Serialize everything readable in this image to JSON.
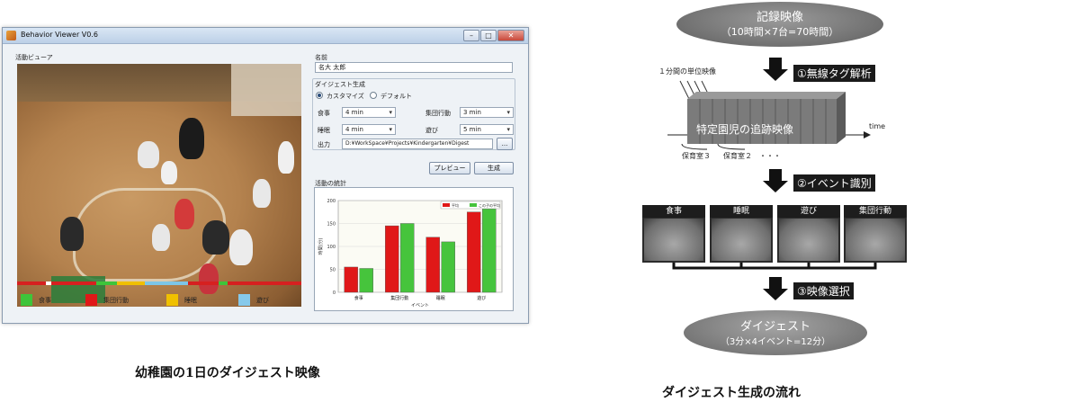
{
  "window": {
    "title": "Behavior Viewer V0.6",
    "controls": {
      "minimize": "–",
      "maximize": "□",
      "close": "✕"
    }
  },
  "viewer": {
    "label": "活動ビューア"
  },
  "timeline": {
    "segments": [
      {
        "color": "#d62020",
        "fraction": 0.1
      },
      {
        "color": "#ffffff",
        "fraction": 0.02
      },
      {
        "color": "#d62020",
        "fraction": 0.16
      },
      {
        "color": "#3ec43a",
        "fraction": 0.07
      },
      {
        "color": "#f0c000",
        "fraction": 0.1
      },
      {
        "color": "#7cc6e8",
        "fraction": 0.15
      },
      {
        "color": "#d62020",
        "fraction": 0.11
      },
      {
        "color": "#3ec43a",
        "fraction": 0.03
      },
      {
        "color": "#d62020",
        "fraction": 0.26
      }
    ]
  },
  "legend": [
    {
      "label": "食事",
      "color": "#3ec43a"
    },
    {
      "label": "集団行動",
      "color": "#e01818"
    },
    {
      "label": "睡眠",
      "color": "#f0c000"
    },
    {
      "label": "遊び",
      "color": "#86c9ea"
    }
  ],
  "form": {
    "name_label": "名前",
    "name_value": "名大 太郎",
    "digest_label": "ダイジェスト生成",
    "radio_custom": "カスタマイズ",
    "radio_default": "デフォルト",
    "meal_label": "食事",
    "meal_value": "4 min",
    "sleep_label": "睡眠",
    "sleep_value": "4 min",
    "group_label": "集団行動",
    "group_value": "3 min",
    "play_label": "遊び",
    "play_value": "5 min",
    "output_label": "出力",
    "output_value": "D:¥WorkSpace¥Projects¥Kindergarten¥Digest",
    "browse_label": "...",
    "preview_button": "プレビュー",
    "generate_button": "生成"
  },
  "stats": {
    "label": "活動の統計"
  },
  "chart_data": {
    "type": "bar",
    "categories": [
      "食事",
      "集団行動",
      "睡眠",
      "遊び"
    ],
    "series": [
      {
        "name": "平均",
        "color": "#e01818",
        "values": [
          55,
          145,
          120,
          175
        ]
      },
      {
        "name": "この子の平均",
        "color": "#46c43c",
        "values": [
          52,
          150,
          110,
          182
        ]
      }
    ],
    "xlabel": "イベント",
    "ylabel": "時間(分)",
    "ylim": [
      0,
      200
    ],
    "yticks": [
      0,
      50,
      100,
      150,
      200
    ],
    "legend_position": "top-right"
  },
  "captions": {
    "left": "幼稚園の1日のダイジェスト映像",
    "right": "ダイジェスト生成の流れ"
  },
  "flow": {
    "top_cloud_title": "記録映像",
    "top_cloud_sub": "（10時間×7台=70時間）",
    "unit_video_label": "１分間の単位映像",
    "step1": "①無線タグ解析",
    "track_label": "特定園児の追跡映像",
    "time_label": "time",
    "room3": "保育室３",
    "room2": "保育室２",
    "dots": "・・・",
    "step2": "②イベント識別",
    "thumbs": [
      "食事",
      "睡眠",
      "遊び",
      "集団行動"
    ],
    "step3": "③映像選択",
    "digest_title": "ダイジェスト",
    "digest_sub": "（3分×4イベント=12分）"
  }
}
